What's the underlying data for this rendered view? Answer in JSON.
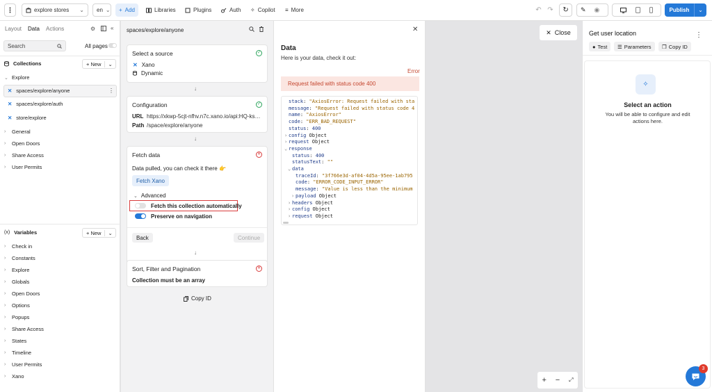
{
  "topbar": {
    "project": "explore stores",
    "lang": "en",
    "add_label": "Add",
    "nav": [
      "Libraries",
      "Plugins",
      "Auth",
      "Copilot",
      "More"
    ],
    "publish_label": "Publish"
  },
  "left": {
    "tabs": [
      "Layout",
      "Data",
      "Actions"
    ],
    "active_tab": "Data",
    "search_placeholder": "Search",
    "all_pages": "All pages",
    "collections_title": "Collections",
    "new_label": "New",
    "explore_group": "Explore",
    "collection_items": [
      "spaces/explore/anyone",
      "spaces/explore/auth",
      "store/explore"
    ],
    "collection_groups": [
      "General",
      "Open Doors",
      "Share Access",
      "User Permits"
    ],
    "variables_title": "Variables",
    "variable_groups": [
      "Check in",
      "Constants",
      "Explore",
      "Globals",
      "Open Doors",
      "Options",
      "Popups",
      "Share Access",
      "States",
      "Timeline",
      "User Permits",
      "Xano"
    ]
  },
  "mid": {
    "header": "spaces/explore/anyone",
    "source": {
      "title": "Select a source",
      "item1": "Xano",
      "item2": "Dynamic"
    },
    "config": {
      "title": "Configuration",
      "url_key": "URL",
      "url_val": "https://xkwp-5cjt-nfhv.n7c.xano.io/api:HQ-ks…",
      "path_key": "Path",
      "path_val": "/space/explore/anyone"
    },
    "fetch": {
      "title": "Fetch data",
      "desc": "Data pulled, you can check it there 👉",
      "button": "Fetch Xano",
      "advanced": "Advanced",
      "opt1": "Fetch this collection automatically",
      "opt2": "Preserve on navigation",
      "back": "Back",
      "continue": "Continue"
    },
    "sort": {
      "title": "Sort, Filter and Pagination",
      "desc": "Collection must be an array"
    },
    "copy_id": "Copy ID"
  },
  "data": {
    "title": "Data",
    "subtitle": "Here is your data, check it out:",
    "error_label": "Error",
    "error_msg": "Request failed with status code 400",
    "code": [
      {
        "ind": 0,
        "caret": "",
        "key": "stack",
        "val": "\"AxiosError: Request failed with sta",
        "t": "s"
      },
      {
        "ind": 0,
        "caret": "",
        "key": "message",
        "val": "\"Request failed with status code 4",
        "t": "s"
      },
      {
        "ind": 0,
        "caret": "",
        "key": "name",
        "val": "\"AxiosError\"",
        "t": "s"
      },
      {
        "ind": 0,
        "caret": "",
        "key": "code",
        "val": "\"ERR_BAD_REQUEST\"",
        "t": "s"
      },
      {
        "ind": 0,
        "caret": "",
        "key": "status",
        "val": "400",
        "t": "n"
      },
      {
        "ind": 0,
        "caret": "›",
        "key": "config",
        "val": "Object",
        "t": "p"
      },
      {
        "ind": 0,
        "caret": "›",
        "key": "request",
        "val": "Object",
        "t": "p"
      },
      {
        "ind": 0,
        "caret": "⌄",
        "key": "response",
        "val": "",
        "t": "p"
      },
      {
        "ind": 1,
        "caret": "",
        "key": "status",
        "val": "400",
        "t": "n"
      },
      {
        "ind": 1,
        "caret": "",
        "key": "statusText",
        "val": "\"\"",
        "t": "s"
      },
      {
        "ind": 1,
        "caret": "⌄",
        "key": "data",
        "val": "",
        "t": "p"
      },
      {
        "ind": 2,
        "caret": "",
        "key": "traceId",
        "val": "\"3f766e3d-af04-4d5a-95ee-1ab795",
        "t": "s"
      },
      {
        "ind": 2,
        "caret": "",
        "key": "code",
        "val": "\"ERROR_CODE_INPUT_ERROR\"",
        "t": "s"
      },
      {
        "ind": 2,
        "caret": "",
        "key": "message",
        "val": "\"Value is less than the minimum",
        "t": "s"
      },
      {
        "ind": 2,
        "caret": "›",
        "key": "payload",
        "val": "Object",
        "t": "p"
      },
      {
        "ind": 1,
        "caret": "›",
        "key": "headers",
        "val": "Object",
        "t": "p"
      },
      {
        "ind": 1,
        "caret": "›",
        "key": "config",
        "val": "Object",
        "t": "p"
      },
      {
        "ind": 1,
        "caret": "›",
        "key": "request",
        "val": "Object",
        "t": "p"
      }
    ]
  },
  "canvas": {
    "close_label": "Close",
    "badge": "3"
  },
  "right": {
    "title": "Get user location",
    "chips": [
      "Test",
      "Parameters",
      "Copy ID"
    ],
    "empty_title": "Select an action",
    "empty_desc": "You will be able to configure and edit actions here."
  },
  "colors": {
    "accent": "#2479d8",
    "error_bg": "#fbe6e1",
    "error_text": "#c4462f",
    "success": "#2aa35a"
  }
}
